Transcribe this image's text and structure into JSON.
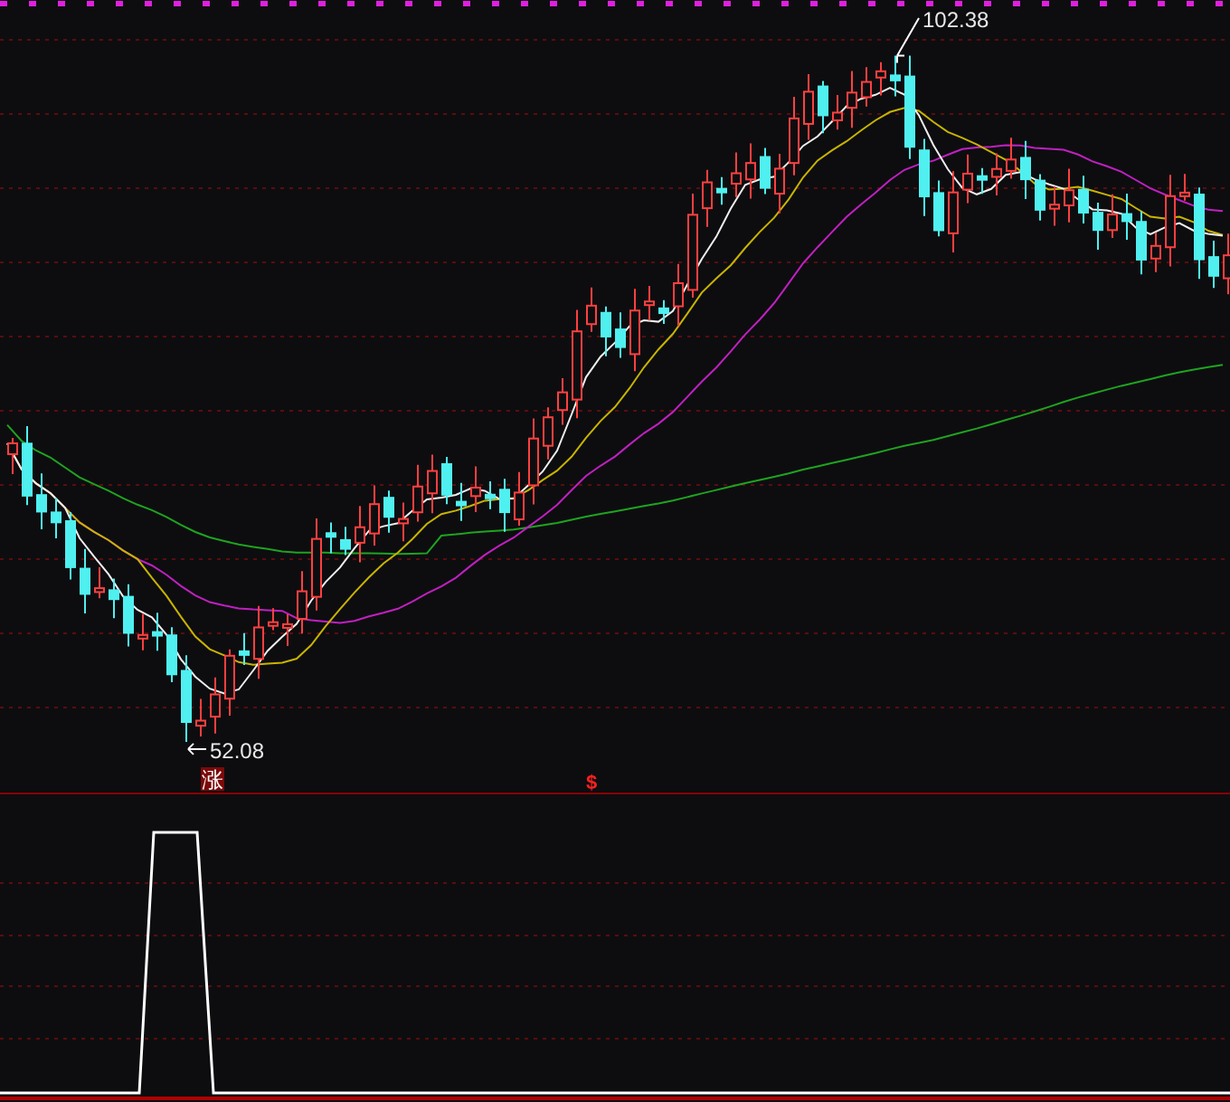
{
  "price_chart": {
    "high_label": "102.38",
    "low_label": "52.08",
    "signal_badge": "涨",
    "signal_mark": "$"
  }
}
